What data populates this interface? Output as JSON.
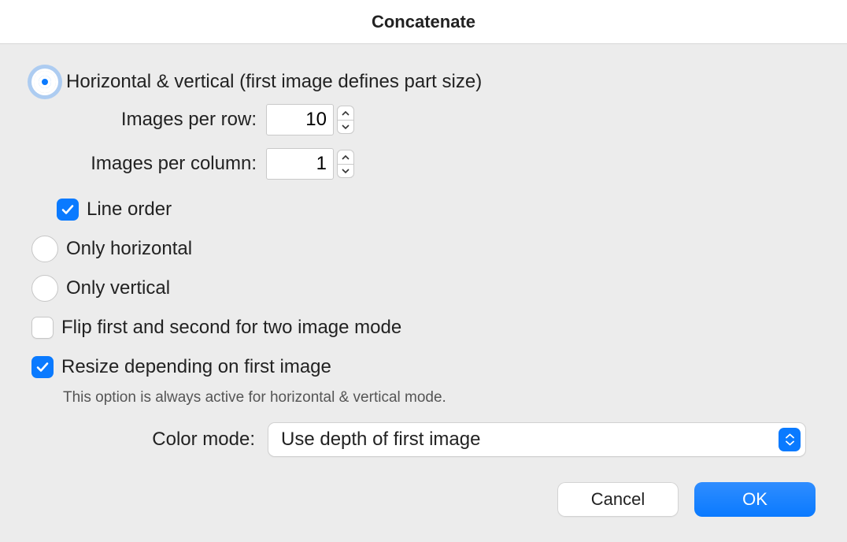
{
  "title": "Concatenate",
  "layout_mode": {
    "horizontal_vertical_label": "Horizontal & vertical (first image defines part size)",
    "only_horizontal_label": "Only horizontal",
    "only_vertical_label": "Only vertical",
    "selected": "horizontal_vertical"
  },
  "images_per_row": {
    "label": "Images per row:",
    "value": "10"
  },
  "images_per_column": {
    "label": "Images per column:",
    "value": "1"
  },
  "line_order": {
    "label": "Line order",
    "checked": true
  },
  "flip_first_second": {
    "label": "Flip first and second for two image mode",
    "checked": false
  },
  "resize_first": {
    "label": "Resize depending on first image",
    "checked": true,
    "hint": "This option is always active for horizontal & vertical mode."
  },
  "color_mode": {
    "label": "Color mode:",
    "selected": "Use depth of first image"
  },
  "buttons": {
    "cancel": "Cancel",
    "ok": "OK"
  }
}
